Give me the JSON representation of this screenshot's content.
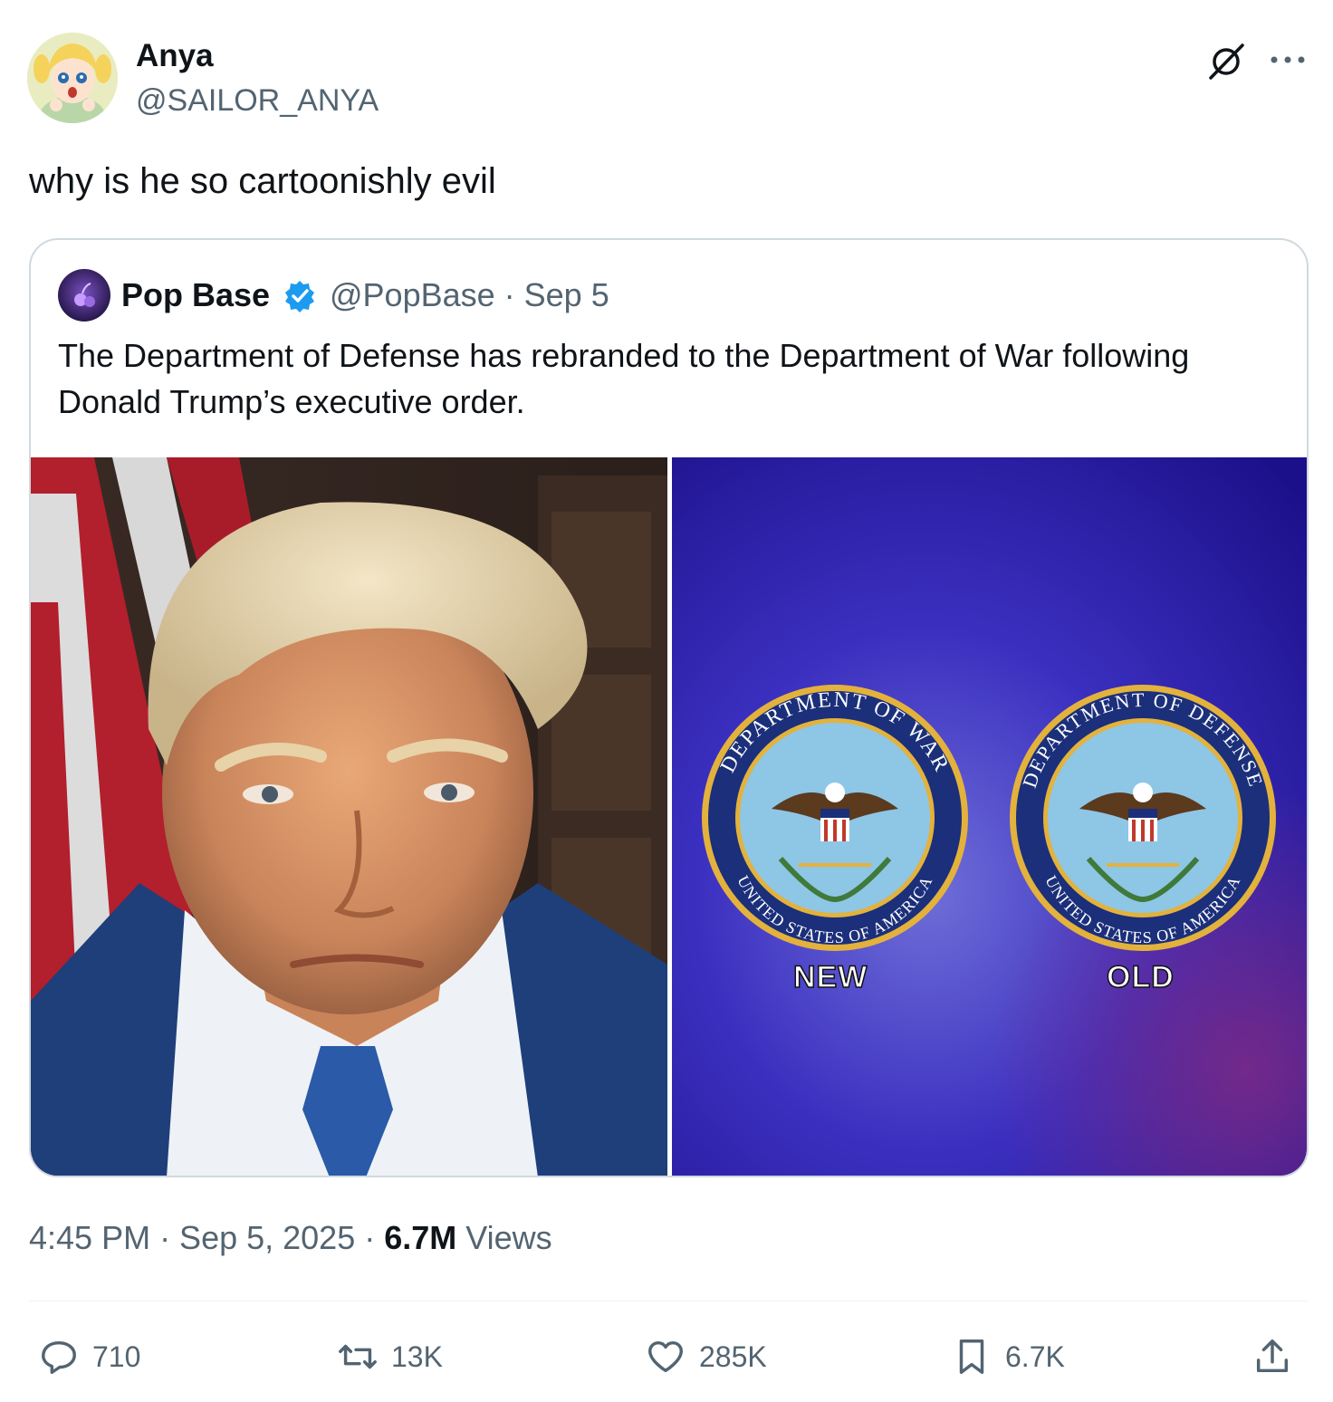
{
  "author": {
    "name": "Anya",
    "handle": "@SAILOR_ANYA"
  },
  "tweet": {
    "text": "why is he so cartoonishly evil"
  },
  "quoted": {
    "name": "Pop Base",
    "handle_date": "@PopBase · Sep 5",
    "text": "The Department of Defense has rebranded to the Department of War following Donald Trump’s executive order.",
    "seals": [
      {
        "ring_text": "DEPARTMENT OF WAR",
        "bottom_text": "UNITED STATES OF AMERICA",
        "label": "NEW"
      },
      {
        "ring_text": "DEPARTMENT OF DEFENSE",
        "bottom_text": "UNITED STATES OF AMERICA",
        "label": "OLD"
      }
    ]
  },
  "meta": {
    "time_date": "4:45 PM · Sep 5, 2025 · ",
    "views_count": "6.7M",
    "views_label": " Views"
  },
  "actions": {
    "replies": "710",
    "reposts": "13K",
    "likes": "285K",
    "bookmarks": "6.7K"
  },
  "colors": {
    "text_primary": "#0f1419",
    "text_secondary": "#536471",
    "verified": "#1d9bf0",
    "border": "#cfd9de"
  }
}
